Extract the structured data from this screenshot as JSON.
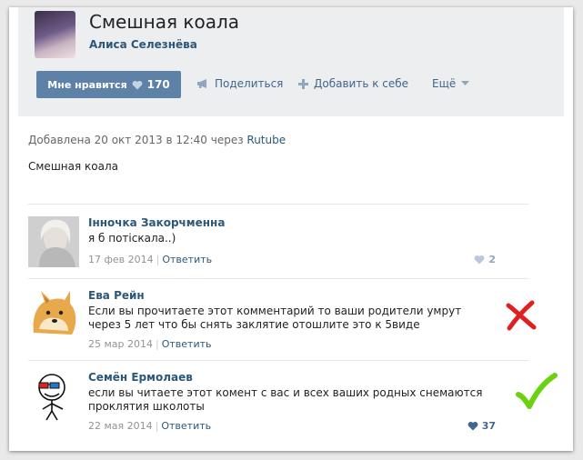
{
  "post": {
    "title": "Смешная коала",
    "author": "Алиса Селезнёва",
    "like_label": "Мне нравится",
    "like_count": "170",
    "share_label": "Поделиться",
    "add_label": "Добавить к себе",
    "more_label": "Ещё",
    "meta_prefix": "Добавлена 20 окт 2013 в 12:40 через",
    "meta_via": "Rutube",
    "description": "Смешная коала"
  },
  "comments": [
    {
      "name": "Інночка Закорчменна",
      "text": "я б потіскала..)",
      "date": "17 фев 2014",
      "reply": "Ответить",
      "likes": "2",
      "like_color": "#8fa5c0"
    },
    {
      "name": "Ева Рейн",
      "text": "Если вы прочитаете этот комментарий то ваши родители умрут через 5 лет что бы снять заклятие отошлите это к 5виде",
      "date": "25 мар 2014",
      "reply": "Ответить",
      "likes": "",
      "mark": "cross-mark",
      "mark_color": "#e02020"
    },
    {
      "name": "Семён Ермолаев",
      "text": "если вы читаете этот комент с вас и всех ваших родных снемаются проклятия школоты",
      "date": "22 мая 2014",
      "reply": "Ответить",
      "likes": "37",
      "like_color": "#45678f",
      "mark": "check-mark",
      "mark_color": "#6cd10f"
    }
  ],
  "colors": {
    "link": "#2b587a",
    "button": "#5e81a8",
    "header_bg": "#edeef0"
  }
}
